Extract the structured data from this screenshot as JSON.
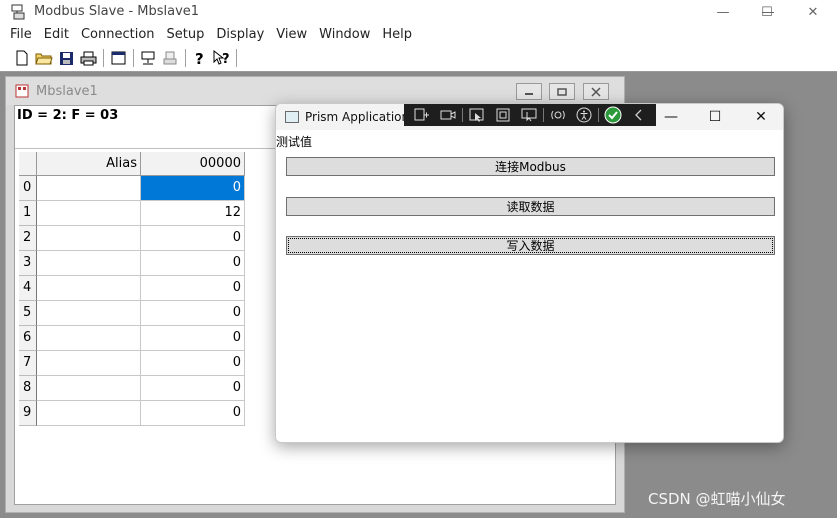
{
  "app": {
    "title": "Modbus Slave - Mbslave1",
    "caption_min": "—",
    "caption_max": "☐",
    "caption_close": "✕"
  },
  "menu": [
    "File",
    "Edit",
    "Connection",
    "Setup",
    "Display",
    "View",
    "Window",
    "Help"
  ],
  "toolbar": {
    "icons": [
      "new-document-icon",
      "open-folder-icon",
      "save-icon",
      "print-icon",
      "window-icon",
      "connect-icon",
      "disconnect-icon",
      "help-icon",
      "context-help-icon"
    ]
  },
  "child": {
    "title": "Mbslave1",
    "id_line": "ID = 2: F = 03",
    "alias_header": "Alias",
    "col_header": "00000",
    "rows": [
      {
        "index": "0",
        "alias": "",
        "value": "0"
      },
      {
        "index": "1",
        "alias": "",
        "value": "12"
      },
      {
        "index": "2",
        "alias": "",
        "value": "0"
      },
      {
        "index": "3",
        "alias": "",
        "value": "0"
      },
      {
        "index": "4",
        "alias": "",
        "value": "0"
      },
      {
        "index": "5",
        "alias": "",
        "value": "0"
      },
      {
        "index": "6",
        "alias": "",
        "value": "0"
      },
      {
        "index": "7",
        "alias": "",
        "value": "0"
      },
      {
        "index": "8",
        "alias": "",
        "value": "0"
      },
      {
        "index": "9",
        "alias": "",
        "value": "0"
      }
    ],
    "selected_row": 0,
    "accent": "#0078d7"
  },
  "prism": {
    "title": "Prism Application",
    "label": "测试值",
    "buttons": [
      "连接Modbus",
      "读取数据",
      "写入数据"
    ],
    "caption_min": "—",
    "caption_max": "☐",
    "caption_close": "✕",
    "debug_icons": [
      "live-visual-tree-icon",
      "record-icon",
      "select-element-icon",
      "display-layout-icon",
      "track-focus-icon",
      "hot-reload-icon",
      "accessibility-icon",
      "binding-ok-icon",
      "collapse-chevron-icon"
    ]
  },
  "watermark": "CSDN @虹喵小仙女"
}
